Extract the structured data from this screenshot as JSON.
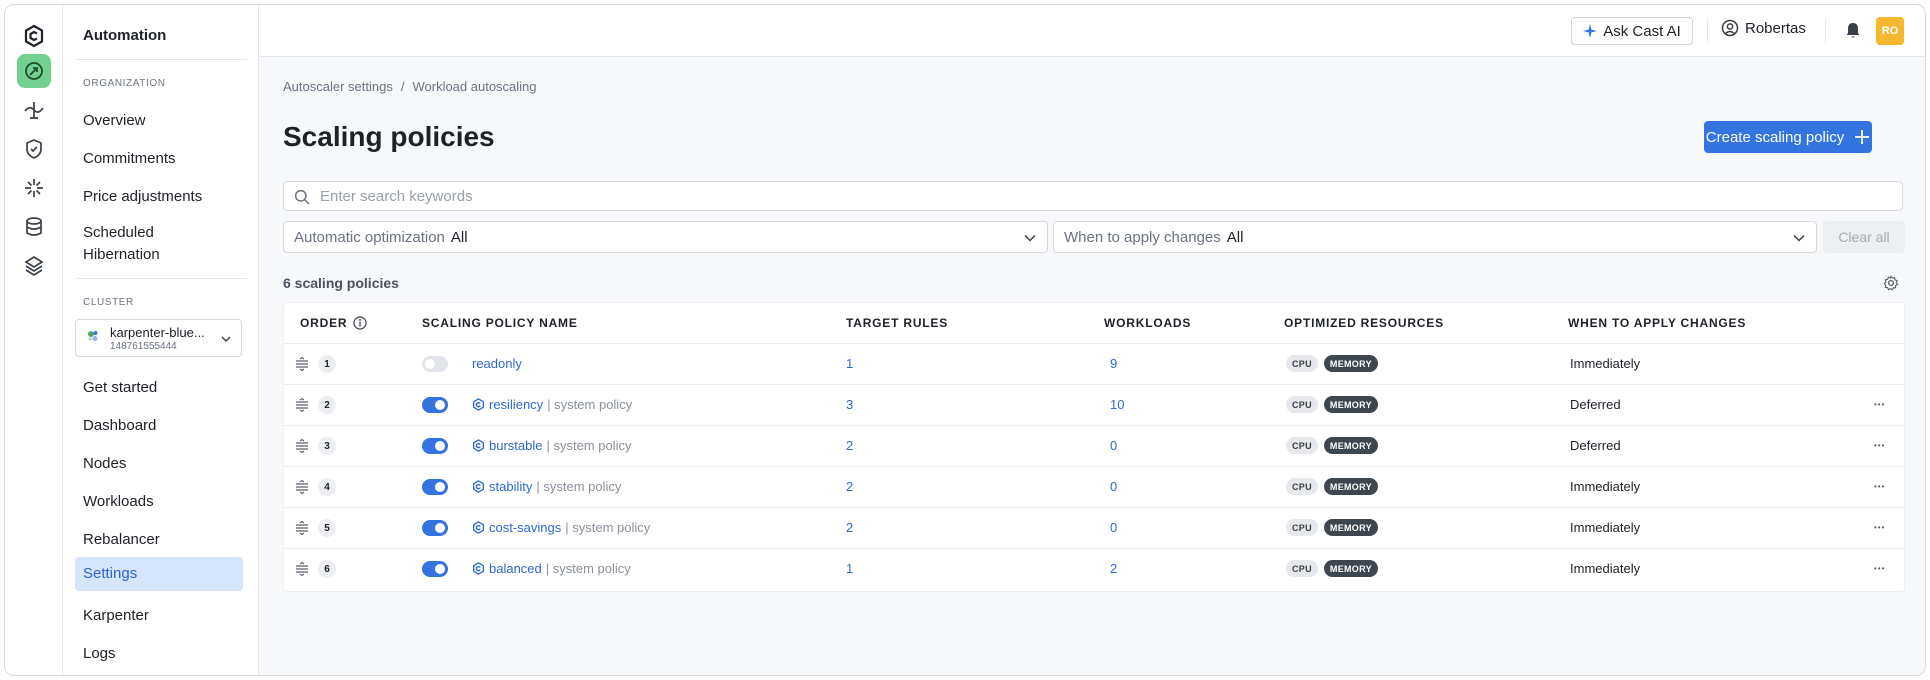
{
  "rail": {
    "icons": [
      "cast-logo-icon",
      "autoscaler-icon",
      "cost-monitoring-icon",
      "security-icon",
      "workload-optimization-icon",
      "database-icon",
      "cluster-icon"
    ]
  },
  "sidebar": {
    "title": "Automation",
    "org_label": "ORGANIZATION",
    "org_items": [
      "Overview",
      "Commitments",
      "Price adjustments",
      "Scheduled Hibernation"
    ],
    "cluster_label": "CLUSTER",
    "cluster_name": "karpenter-blue...",
    "cluster_id": "148761555444",
    "cluster_items": [
      "Get started",
      "Dashboard",
      "Nodes",
      "Workloads",
      "Rebalancer",
      "Settings",
      "Karpenter",
      "Logs"
    ],
    "active_item": "Settings"
  },
  "topbar": {
    "ask_label": "Ask Cast AI",
    "user_name": "Robertas",
    "avatar_initials": "RO"
  },
  "main": {
    "breadcrumb": [
      "Autoscaler settings",
      "/",
      "Workload autoscaling"
    ],
    "title": "Scaling policies",
    "create_label": "Create scaling policy",
    "search_placeholder": "Enter search keywords",
    "filter1": {
      "label": "Automatic optimization",
      "value": "All"
    },
    "filter2": {
      "label": "When to apply changes",
      "value": "All"
    },
    "clear_label": "Clear all",
    "count_label": "6 scaling policies"
  },
  "table": {
    "headers": {
      "order": "ORDER",
      "name": "SCALING POLICY NAME",
      "target": "TARGET RULES",
      "workloads": "WORKLOADS",
      "resources": "OPTIMIZED RESOURCES",
      "when": "WHEN TO APPLY CHANGES"
    },
    "system_suffix": "| system policy",
    "rows": [
      {
        "order": "1",
        "enabled": false,
        "name": "readonly",
        "system": false,
        "target_rules": "1",
        "workloads": "9",
        "cpu": "CPU",
        "memory": "MEMORY",
        "when": "Immediately",
        "has_menu": false
      },
      {
        "order": "2",
        "enabled": true,
        "name": "resiliency",
        "system": true,
        "target_rules": "3",
        "workloads": "10",
        "cpu": "CPU",
        "memory": "MEMORY",
        "when": "Deferred",
        "has_menu": true
      },
      {
        "order": "3",
        "enabled": true,
        "name": "burstable",
        "system": true,
        "target_rules": "2",
        "workloads": "0",
        "cpu": "CPU",
        "memory": "MEMORY",
        "when": "Deferred",
        "has_menu": true
      },
      {
        "order": "4",
        "enabled": true,
        "name": "stability",
        "system": true,
        "target_rules": "2",
        "workloads": "0",
        "cpu": "CPU",
        "memory": "MEMORY",
        "when": "Immediately",
        "has_menu": true
      },
      {
        "order": "5",
        "enabled": true,
        "name": "cost-savings",
        "system": true,
        "target_rules": "2",
        "workloads": "0",
        "cpu": "CPU",
        "memory": "MEMORY",
        "when": "Immediately",
        "has_menu": true
      },
      {
        "order": "6",
        "enabled": true,
        "name": "balanced",
        "system": true,
        "target_rules": "1",
        "workloads": "2",
        "cpu": "CPU",
        "memory": "MEMORY",
        "when": "Immediately",
        "has_menu": true
      }
    ]
  },
  "colors": {
    "accent": "#3474e0",
    "link": "#2e68d2",
    "active_rail": "#74d08f",
    "avatar": "#f5b82e"
  }
}
